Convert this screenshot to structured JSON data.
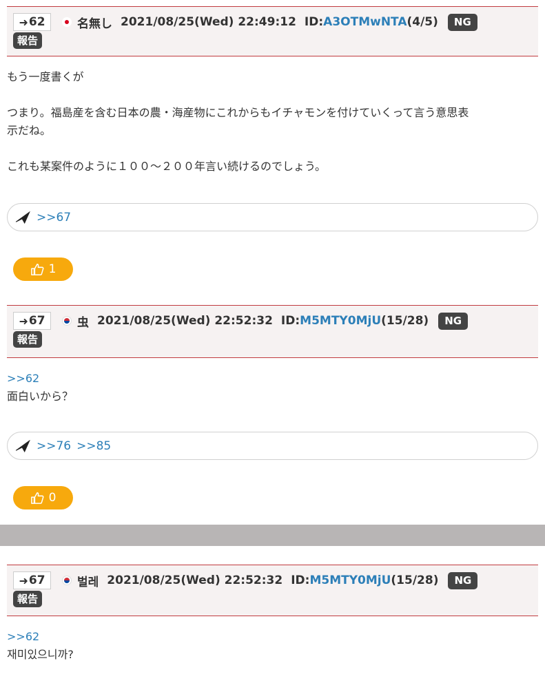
{
  "posts": [
    {
      "number": "62",
      "name": "名無し",
      "datetime": "2021/08/25(Wed) 22:49:12",
      "id_label": "ID:",
      "id_value": "A3OTMwNTA",
      "id_count": "(4/5)",
      "ng_label": "NG",
      "report_label": "報告",
      "body_lines": [
        "もう一度書くが",
        "",
        "つまり。福島産を含む日本の農・海産物にこれからもイチャモンを付けていくって言う意思表",
        "示だね。",
        "",
        "これも某案件のように１００～２００年言い続けるのでしょう。"
      ],
      "replies": [
        ">>67"
      ],
      "likes": "1"
    },
    {
      "number": "67",
      "name": "虫",
      "datetime": "2021/08/25(Wed) 22:52:32",
      "id_label": "ID:",
      "id_value": "M5MTY0MjU",
      "id_count": "(15/28)",
      "ng_label": "NG",
      "report_label": "報告",
      "body_anchor": ">>62",
      "body_lines": [
        "面白いから？"
      ],
      "replies": [
        ">>76",
        ">>85"
      ],
      "likes": "0"
    },
    {
      "number": "67",
      "name": "벌레",
      "datetime": "2021/08/25(Wed) 22:52:32",
      "id_label": "ID:",
      "id_value": "M5MTY0MjU",
      "id_count": "(15/28)",
      "ng_label": "NG",
      "report_label": "報告",
      "body_anchor": ">>62",
      "body_lines": [
        "재미있으니까?"
      ]
    }
  ],
  "icons": {
    "resnum": "share-arrow-icon",
    "flag_jp": "flag-jp-icon",
    "flag_kr": "flag-kr-icon",
    "replies": "paper-plane-icon",
    "like": "thumbs-up-icon"
  },
  "colors": {
    "header_border": "#c0393e",
    "header_bg": "#f6f2f2",
    "link": "#2c7fb8",
    "like": "#f7a90d",
    "button_dark": "#444444",
    "divider": "#b8b5b5"
  }
}
